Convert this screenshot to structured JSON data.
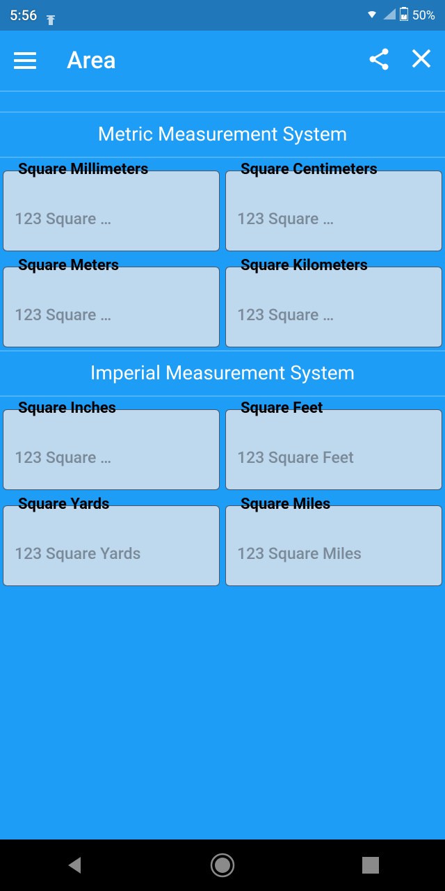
{
  "status": {
    "time": "5:56",
    "battery": "50%"
  },
  "header": {
    "title": "Area"
  },
  "sections": [
    {
      "title": "Metric Measurement System",
      "fields": [
        {
          "label": "Square Millimeters",
          "placeholder": "123 Square …"
        },
        {
          "label": "Square Centimeters",
          "placeholder": "123 Square …"
        },
        {
          "label": "Square Meters",
          "placeholder": "123 Square …"
        },
        {
          "label": "Square Kilometers",
          "placeholder": "123 Square …"
        }
      ]
    },
    {
      "title": "Imperial Measurement System",
      "fields": [
        {
          "label": "Square Inches",
          "placeholder": "123 Square …"
        },
        {
          "label": "Square Feet",
          "placeholder": "123 Square Feet"
        },
        {
          "label": "Square Yards",
          "placeholder": "123 Square Yards"
        },
        {
          "label": "Square Miles",
          "placeholder": "123 Square Miles"
        }
      ]
    }
  ]
}
